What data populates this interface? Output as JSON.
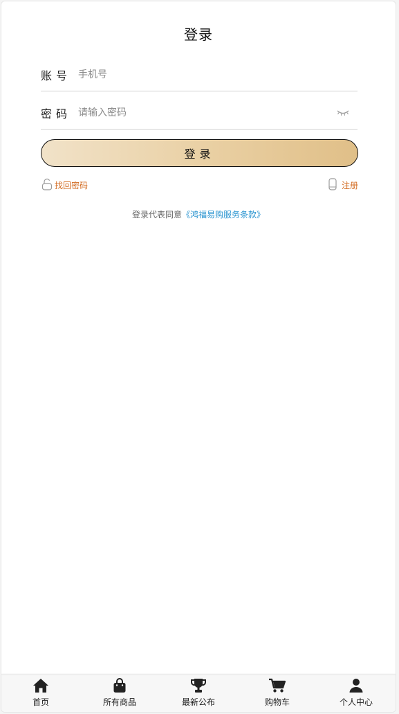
{
  "header": {
    "title": "登录"
  },
  "form": {
    "account_label": "账号",
    "account_placeholder": "手机号",
    "password_label": "密码",
    "password_placeholder": "请输入密码",
    "submit_label": "登录"
  },
  "links": {
    "forgot_password": "找回密码",
    "register": "注册"
  },
  "agreement": {
    "prefix": "登录代表同意",
    "terms": "《鸿福易购服务条款》"
  },
  "tabbar": {
    "items": [
      {
        "label": "首页",
        "icon": "home-icon"
      },
      {
        "label": "所有商品",
        "icon": "shopping-bag-icon"
      },
      {
        "label": "最新公布",
        "icon": "trophy-icon"
      },
      {
        "label": "购物车",
        "icon": "cart-icon"
      },
      {
        "label": "个人中心",
        "icon": "user-icon"
      }
    ]
  },
  "colors": {
    "link_orange": "#d2691e",
    "terms_blue": "#2a94d0",
    "button_gold": "#e9cfa2"
  }
}
